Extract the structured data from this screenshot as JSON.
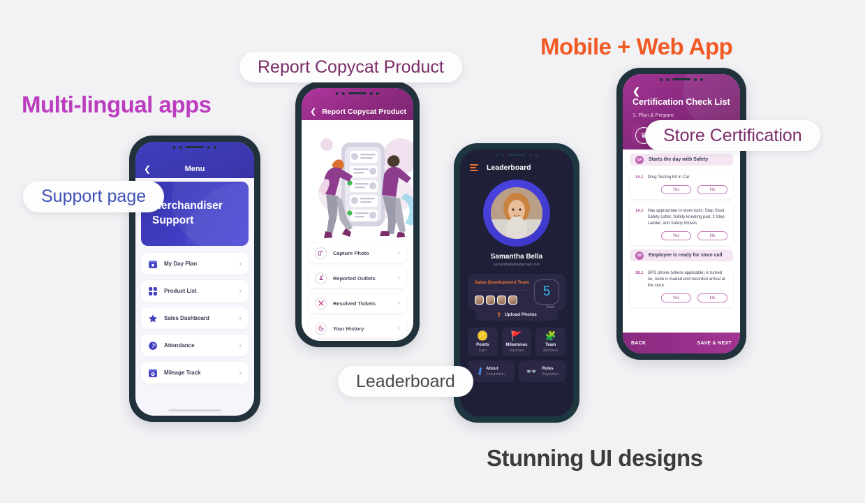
{
  "background_color": "#f2f2f5",
  "headings": [
    {
      "id": "multilingual",
      "text": "Multi-lingual apps",
      "color": "#bc3cc0"
    },
    {
      "id": "mobileweb",
      "text": "Mobile + Web App",
      "color": "#f15a24"
    },
    {
      "id": "stunning",
      "text": "Stunning UI designs",
      "color": "#3b3b3b"
    }
  ],
  "callouts": [
    {
      "id": "support",
      "text": "Support page",
      "color": "#3f51b5"
    },
    {
      "id": "report",
      "text": "Report Copycat Product",
      "color": "#7b2d69"
    },
    {
      "id": "leaderboard",
      "text": "Leaderboard",
      "color": "#4a4a4a"
    },
    {
      "id": "storecert",
      "text": "Store Certification",
      "color": "#7b2d69"
    }
  ],
  "phone_support": {
    "nav": {
      "back_icon": "chevron-left-icon",
      "title": "Menu"
    },
    "hero": {
      "line1": "Merchandiser",
      "line2": "Support"
    },
    "menu_items": [
      {
        "label": "My Day Plan",
        "icon": "calendar-icon",
        "chevron": "›"
      },
      {
        "label": "Product List",
        "icon": "grid-icon",
        "chevron": "›"
      },
      {
        "label": "Sales Dashboard",
        "icon": "star-icon",
        "chevron": "›"
      },
      {
        "label": "Attendance",
        "icon": "fingerprint-icon",
        "chevron": "›"
      },
      {
        "label": "Mileage Track",
        "icon": "odometer-icon",
        "chevron": "›"
      }
    ]
  },
  "phone_copycat": {
    "nav": {
      "back_icon": "chevron-left-icon",
      "title": "Report Copycat Product"
    },
    "illustration": "two-people-checklist-illustration",
    "menu_items": [
      {
        "label": "Capture Photo",
        "icon": "camera-icon",
        "chevron": "›"
      },
      {
        "label": "Reported Outlets",
        "icon": "person-refresh-icon",
        "chevron": "›"
      },
      {
        "label": "Resolved Tickets",
        "icon": "cross-ticket-icon",
        "chevron": "›"
      },
      {
        "label": "Your History",
        "icon": "clock-history-icon",
        "chevron": "›"
      }
    ]
  },
  "phone_leaderboard": {
    "nav": {
      "menu_icon": "hamburger-icon",
      "title": "Leaderboard"
    },
    "profile": {
      "name": "Samantha Bella",
      "email": "samanthabella@email.com",
      "avatar": "user-avatar"
    },
    "team_card": {
      "team_name": "Sales Development Team",
      "rank_value": "5",
      "rank_label": "Rank",
      "member_count": 4
    },
    "upload": {
      "label": "Upload Photos",
      "icon": "upload-icon"
    },
    "tiles": [
      {
        "title": "Points",
        "subtitle": "Earn",
        "icon": "coins-icon",
        "glyph": "🪙",
        "wide": false
      },
      {
        "title": "Milestones",
        "subtitle": "Important",
        "icon": "flag-icon",
        "glyph": "🚩",
        "wide": false
      },
      {
        "title": "Team",
        "subtitle": "Members",
        "icon": "team-icon",
        "glyph": "🧩",
        "wide": false
      },
      {
        "title": "About",
        "subtitle": "Competition",
        "icon": "info-icon",
        "glyph": "ℹ",
        "wide": true
      },
      {
        "title": "Rules",
        "subtitle": "Regulation",
        "icon": "rules-icon",
        "glyph": "👓",
        "wide": true
      }
    ]
  },
  "phone_certification": {
    "nav": {
      "back_icon": "chevron-left-icon"
    },
    "title": "Certification Check List",
    "subtitle": "1. Plan & Prepare",
    "badge_icon": "certification-badge-icon",
    "sections": [
      {
        "num": "1A",
        "heading": "Starts the day with Safety",
        "questions": [
          {
            "no": "1A.1",
            "text": "Drug Testing Kit in Car",
            "yes": "Yes",
            "no_label": "No"
          },
          {
            "no": "1A.2",
            "text": "Has appropriate in-store tools:  Step Stool, Safety cutter, Safety kneeling pad, 2 Step Ladder, and Safety Gloves",
            "yes": "Yes",
            "no_label": "No"
          }
        ]
      },
      {
        "num": "1B",
        "heading": "Employee is ready for store call",
        "questions": [
          {
            "no": "1B.1",
            "text": "GPS phone (where applicable) is turned on, route is loaded and recorded arrival at the store.",
            "yes": "Yes",
            "no_label": "No"
          }
        ]
      }
    ],
    "footer": {
      "back": "BACK",
      "next": "SAVE & NEXT"
    }
  }
}
